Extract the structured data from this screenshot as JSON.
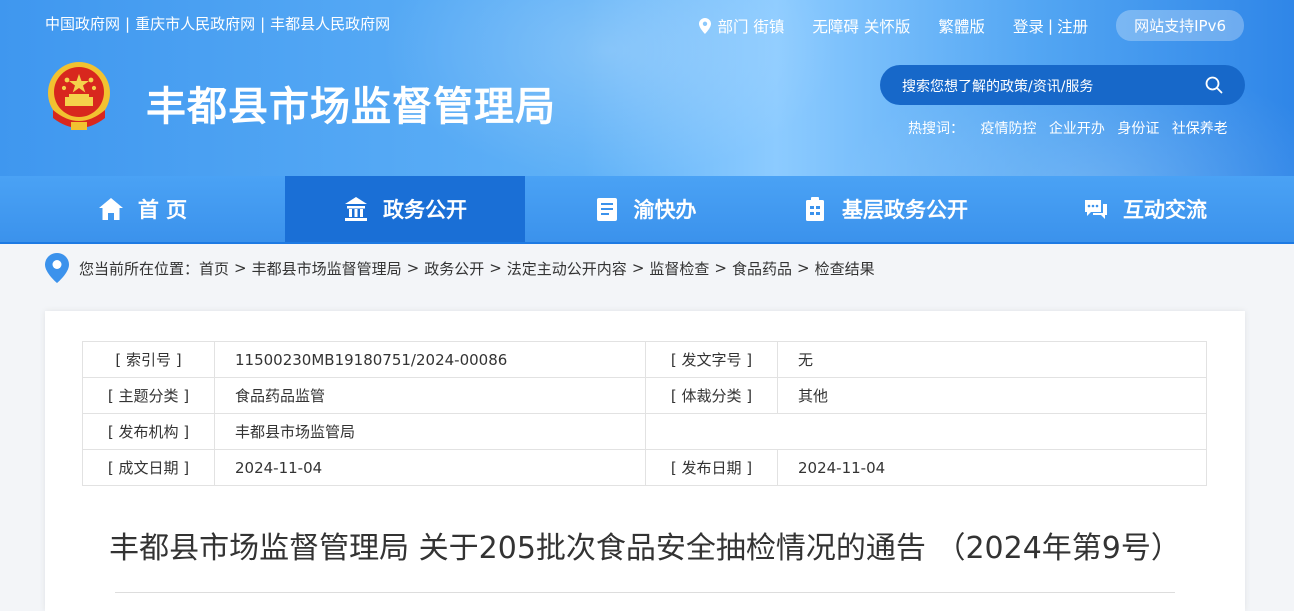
{
  "top_links": [
    "中国政府网",
    "重庆市人民政府网",
    "丰都县人民政府网"
  ],
  "top_right": {
    "departments": "部门 街镇",
    "accessibility": "无障碍 关怀版",
    "traditional": "繁體版",
    "login": "登录",
    "register": "注册",
    "ipv6": "网站支持IPv6"
  },
  "site_title": "丰都县市场监督管理局",
  "search": {
    "placeholder": "搜索您想了解的政策/资讯/服务"
  },
  "hot_search": {
    "label": "热搜词：",
    "terms": [
      "疫情防控",
      "企业开办",
      "身份证",
      "社保养老"
    ]
  },
  "nav": {
    "tabs": [
      {
        "label": "首 页",
        "icon": "home-icon"
      },
      {
        "label": "政务公开",
        "icon": "government-icon",
        "active": true
      },
      {
        "label": "渝快办",
        "icon": "document-icon"
      },
      {
        "label": "基层政务公开",
        "icon": "building-icon"
      },
      {
        "label": "互动交流",
        "icon": "chat-icon"
      }
    ]
  },
  "breadcrumb": {
    "prefix": "您当前所在位置：",
    "items": [
      "首页",
      "丰都县市场监督管理局",
      "政务公开",
      "法定主动公开内容",
      "监督检查",
      "食品药品",
      "检查结果"
    ]
  },
  "meta": {
    "index_no_label": "[ 索引号 ]",
    "index_no": "11500230MB19180751/2024-00086",
    "doc_no_label": "[ 发文字号 ]",
    "doc_no": "无",
    "topic_label": "[ 主题分类 ]",
    "topic": "食品药品监管",
    "genre_label": "[ 体裁分类 ]",
    "genre": "其他",
    "publisher_label": "[ 发布机构 ]",
    "publisher": "丰都县市场监管局",
    "created_label": "[ 成文日期 ]",
    "created": "2024-11-04",
    "published_label": "[ 发布日期 ]",
    "published": "2024-11-04"
  },
  "document_title": "丰都县市场监督管理局 关于205批次食品安全抽检情况的通告 （2024年第9号）",
  "colors": {
    "header_blue": "#3f97ef",
    "nav_active": "#1a6fd6",
    "search_bg": "#1768c9"
  }
}
